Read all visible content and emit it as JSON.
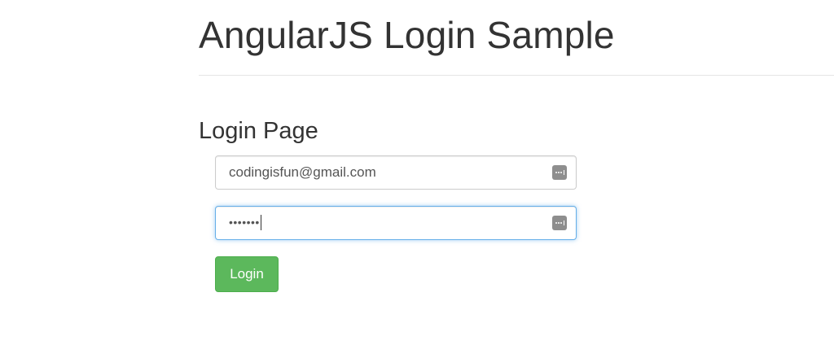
{
  "header": {
    "title": "AngularJS Login Sample"
  },
  "login": {
    "section_title": "Login Page",
    "email_value": "codingisfun@gmail.com",
    "password_mask": "•••••••",
    "button_label": "Login"
  },
  "colors": {
    "button_bg": "#5cb85c",
    "focus_border": "#66afe9",
    "text": "#333333"
  },
  "icons": {
    "field_autofill": "keychain-autofill-icon"
  }
}
